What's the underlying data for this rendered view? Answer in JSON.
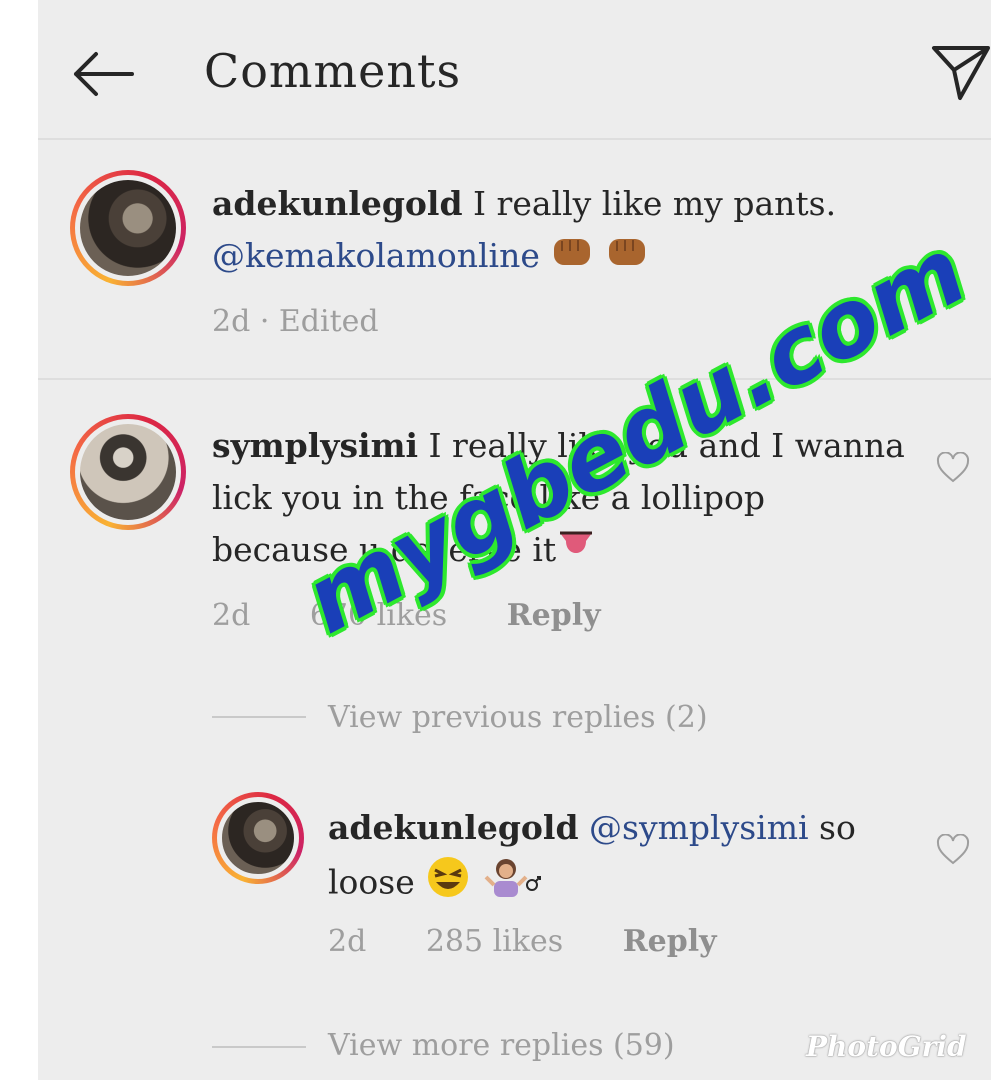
{
  "header": {
    "title": "Comments"
  },
  "comments": [
    {
      "username": "adekunlegold",
      "text": " I really like my pants.",
      "mention": "@kemakolamonline",
      "time": "2d",
      "edited": " · Edited"
    },
    {
      "username": "symplysimi",
      "line1": " I really like you and I wanna",
      "line2": "lick you in the face like a lollipop",
      "line3": "because u deserve it",
      "time": "2d",
      "likes": "670 likes",
      "reply": "Reply",
      "view_previous": "View previous replies (2)",
      "replies": [
        {
          "username": "adekunlegold",
          "mention": "@symplysimi",
          "line1_tail": " so",
          "line2": "loose",
          "time": "2d",
          "likes": "285 likes",
          "reply": "Reply"
        }
      ],
      "view_more": "View more replies (59)"
    }
  ],
  "overlays": {
    "watermark": "mygbedu.com",
    "photogrid": "PhotoGrid"
  },
  "colors": {
    "background": "#ededed",
    "mention": "#2d4a8a",
    "meta": "#9e9e9e",
    "watermark_fill": "#1a3fb8",
    "watermark_outline": "#2ee82e"
  },
  "icons": [
    "back-arrow-icon",
    "direct-send-icon",
    "heart-icon",
    "fist-emoji",
    "tongue-emoji",
    "laughing-emoji",
    "shrug-emoji"
  ]
}
